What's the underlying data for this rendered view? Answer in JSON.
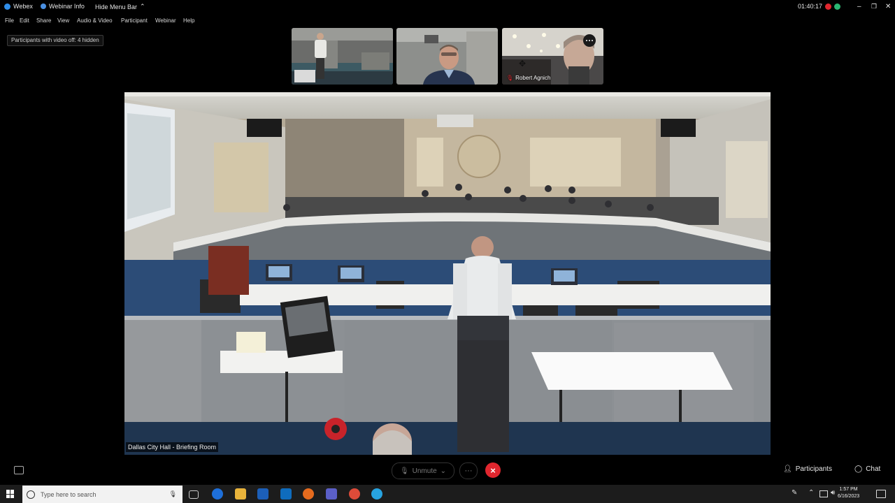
{
  "titlebar": {
    "app": "Webex",
    "webinar_info": "Webinar Info",
    "hide_menu": "Hide Menu Bar",
    "timer": "01:40:17"
  },
  "menu": [
    "File",
    "Edit",
    "Share",
    "View",
    "Audio & Video",
    "Participant",
    "Webinar",
    "Help"
  ],
  "video_off_notice": "Participants with video off: 4 hidden",
  "thumbnails": [
    {
      "name": ""
    },
    {
      "name": ""
    },
    {
      "name": "Robert Agnich"
    }
  ],
  "main_video": {
    "label": "Dallas City Hall - Briefing Room"
  },
  "controls": {
    "unmute": "Unmute",
    "more": "···",
    "leave": "×",
    "participants": "Participants",
    "chat": "Chat"
  },
  "taskbar": {
    "search_placeholder": "Type here to search",
    "time": "1:57 PM",
    "date": "6/16/2023"
  },
  "colors": {
    "leave_red": "#e0262e",
    "bg": "#000000"
  }
}
